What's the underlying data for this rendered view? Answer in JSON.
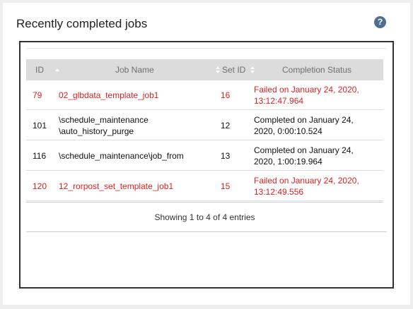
{
  "panel": {
    "title": "Recently completed jobs",
    "help_icon": "question-circle-icon",
    "help_glyph": "?"
  },
  "colors": {
    "failed": "#dd2222",
    "header_bg": "#dcdcdc",
    "help_icon_bg": "#4f6f8f"
  },
  "table": {
    "columns": [
      "ID",
      "Job Name",
      "Set ID",
      "Completion Status"
    ],
    "sort": {
      "column": "ID",
      "direction": "ascending"
    },
    "rows": [
      {
        "id": "79",
        "job_name": [
          "02_glbdata_template_job1"
        ],
        "set_id": "16",
        "status": [
          "Failed on January 24, 2020,",
          "13:12:47.964"
        ],
        "state": "failed"
      },
      {
        "id": "101",
        "job_name": [
          "\\schedule_maintenance",
          "\\auto_history_purge"
        ],
        "set_id": "12",
        "status": [
          "Completed on January 24,",
          "2020, 0:00:10.524"
        ],
        "state": "completed"
      },
      {
        "id": "116",
        "job_name": [
          "\\schedule_maintenance\\job_from"
        ],
        "set_id": "13",
        "status": [
          "Completed on January 24,",
          "2020, 1:00:19.964"
        ],
        "state": "completed"
      },
      {
        "id": "120",
        "job_name": [
          "12_rorpost_set_template_job1"
        ],
        "set_id": "15",
        "status": [
          "Failed on January 24, 2020,",
          "13:12:49.556"
        ],
        "state": "failed"
      }
    ],
    "info": "Showing 1 to 4 of 4 entries"
  }
}
